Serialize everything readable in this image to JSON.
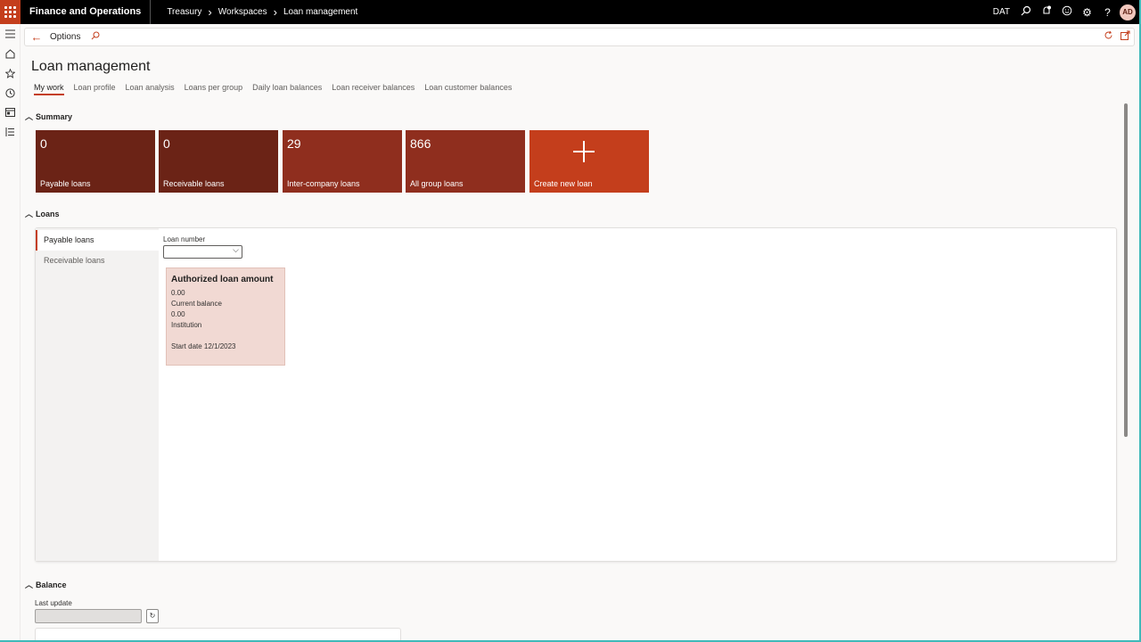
{
  "app": {
    "name": "Finance and Operations"
  },
  "breadcrumb": [
    "Treasury",
    "Workspaces",
    "Loan management"
  ],
  "header": {
    "company": "DAT",
    "avatar_initials": "AD"
  },
  "action_pane": {
    "options_label": "Options"
  },
  "page": {
    "title": "Loan management",
    "tabs": [
      {
        "label": "My work",
        "active": true
      },
      {
        "label": "Loan profile"
      },
      {
        "label": "Loan analysis"
      },
      {
        "label": "Loans per group"
      },
      {
        "label": "Daily loan balances"
      },
      {
        "label": "Loan receiver balances"
      },
      {
        "label": "Loan customer balances"
      }
    ]
  },
  "summary": {
    "title": "Summary",
    "tiles": [
      {
        "value": "0",
        "label": "Payable loans",
        "color": "#6b2316"
      },
      {
        "value": "0",
        "label": "Receivable loans",
        "color": "#6b2316"
      },
      {
        "value": "29",
        "label": "Inter-company loans",
        "color": "#8f2e1e"
      },
      {
        "value": "866",
        "label": "All group loans",
        "color": "#8f2e1e"
      },
      {
        "label": "Create new loan",
        "color": "#c43e1c"
      }
    ]
  },
  "loans": {
    "title": "Loans",
    "nav": [
      {
        "label": "Payable loans",
        "active": true
      },
      {
        "label": "Receivable loans"
      }
    ],
    "loan_number_label": "Loan number",
    "loan_number_value": "",
    "card": {
      "title": "Authorized loan amount",
      "authorized_amount": "0.00",
      "current_balance_label": "Current balance",
      "current_balance": "0.00",
      "institution_label": "Institution",
      "start_date": "Start date 12/1/2023"
    }
  },
  "balance": {
    "title": "Balance",
    "last_update_label": "Last update",
    "last_update_value": ""
  },
  "colors": {
    "accent": "#c43e1c",
    "topbar": "#000000"
  }
}
